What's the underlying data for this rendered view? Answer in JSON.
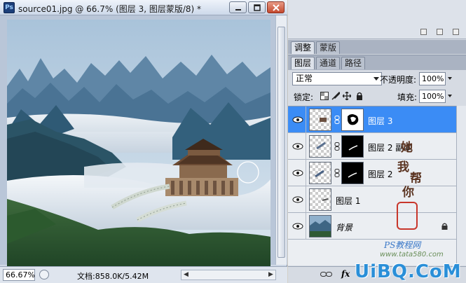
{
  "document": {
    "app_icon": "Ps",
    "title": "source01.jpg @ 66.7% (图层 3, 图层蒙版/8) *",
    "zoom": "66.67%",
    "doc_info": "文档:858.0K/5.42M"
  },
  "panels": {
    "tabs_top": [
      {
        "label": "调整",
        "active": true
      },
      {
        "label": "蒙版",
        "active": false
      }
    ],
    "tabs_layers": [
      {
        "label": "图层",
        "active": true
      },
      {
        "label": "通道",
        "active": false
      },
      {
        "label": "路径",
        "active": false
      }
    ],
    "blend_mode": "正常",
    "opacity_label": "不透明度:",
    "opacity_value": "100%",
    "lock_label": "锁定:",
    "fill_label": "填充:",
    "fill_value": "100%",
    "layers": [
      {
        "name": "图层 3",
        "selected": true,
        "has_mask": true
      },
      {
        "name": "图层 2 副本",
        "selected": false,
        "has_mask": true
      },
      {
        "name": "图层 2",
        "selected": false,
        "has_mask": true
      },
      {
        "name": "图层 1",
        "selected": false,
        "has_mask": false
      },
      {
        "name": "背景",
        "selected": false,
        "has_mask": false,
        "locked": true
      }
    ],
    "fx_label": "fx"
  },
  "watermark": {
    "vertical_chars": [
      "她",
      "我",
      "帮",
      "你"
    ],
    "small_text": "PS教程网",
    "url": "www.tata580.com",
    "brand": "UiBQ.CoM"
  },
  "colors": {
    "selection": "#3b8cf5",
    "panel_bg": "#d6dbe3",
    "brand_blue": "#2a8fd8"
  }
}
